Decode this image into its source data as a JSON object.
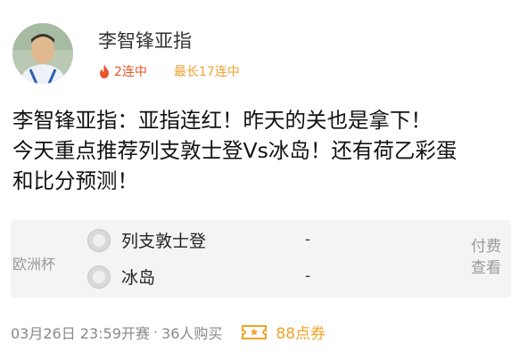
{
  "author": {
    "name": "李智锋亚指",
    "streak_current": "2连中",
    "streak_best": "最长17连中"
  },
  "post": {
    "line1": "李智锋亚指：亚指连红！昨天的关也是拿下！",
    "line2": "今天重点推荐列支敦士登Vs冰岛！还有荷乙彩蛋",
    "line3": "和比分预测！"
  },
  "match": {
    "league": "欧洲杯",
    "home_team": "列支敦士登",
    "away_team": "冰岛",
    "home_score": "-",
    "away_score": "-",
    "pay_label_1": "付费",
    "pay_label_2": "查看"
  },
  "footer": {
    "start_time": "03月26日 23:59开赛",
    "separator": "·",
    "buyers": "36人购买",
    "price": "88点券"
  },
  "colors": {
    "streak_current": "#e8552d",
    "streak_best": "#f0a030",
    "price": "#f2a227",
    "card_bg": "#f4f4f4"
  },
  "icons": {
    "streak": "flame-icon",
    "price": "ticket-icon",
    "team": "team-badge-icon"
  }
}
